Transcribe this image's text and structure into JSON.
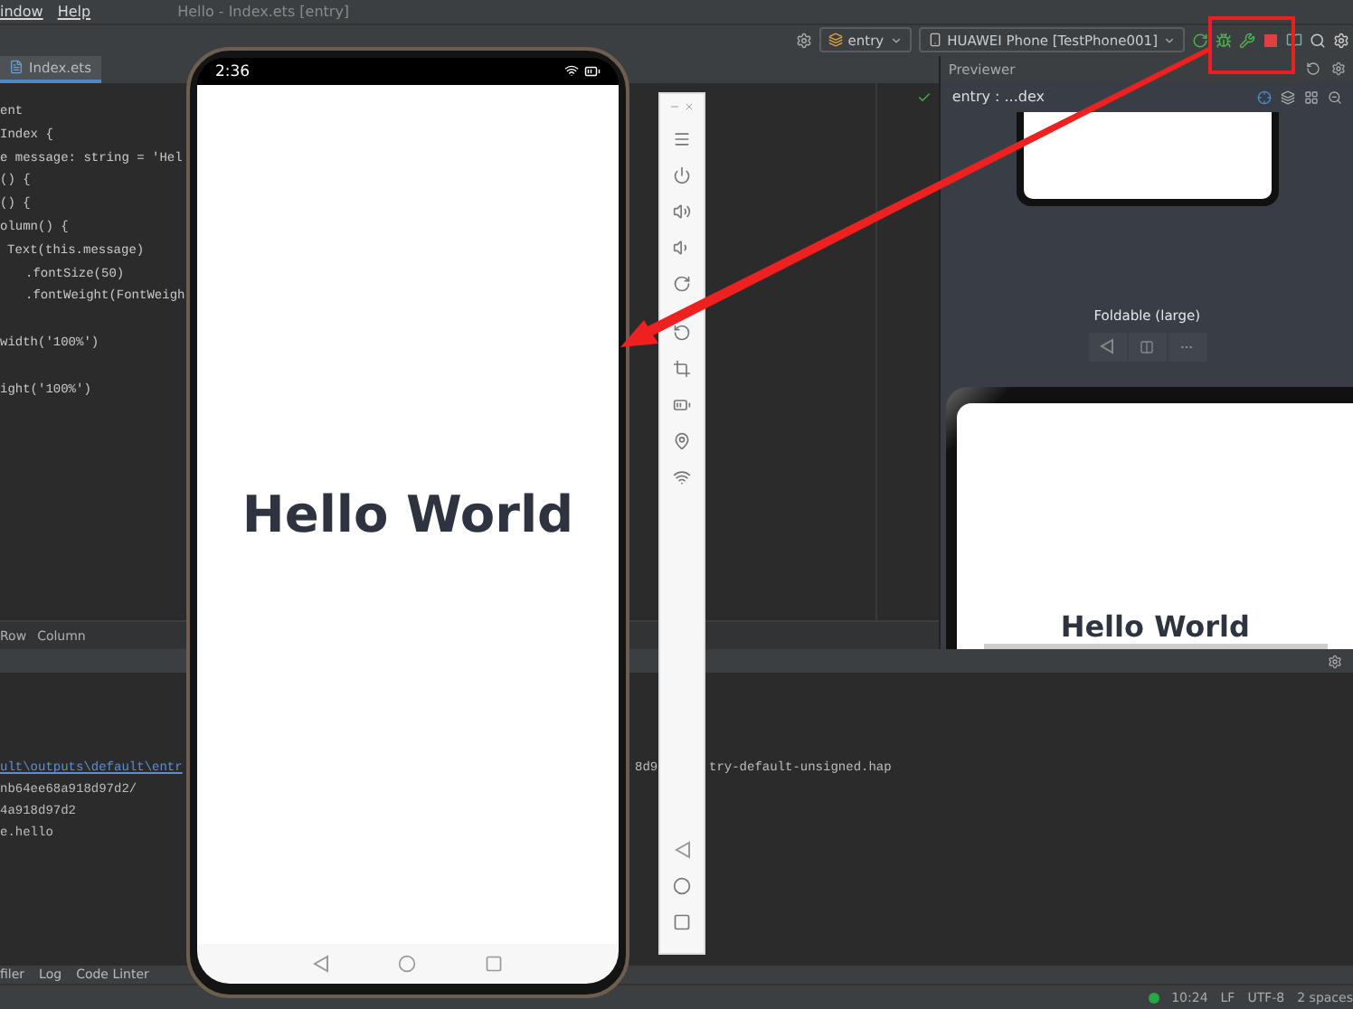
{
  "menu": [
    {
      "label": "indow"
    },
    {
      "label": "Help"
    }
  ],
  "window_title": "Hello - Index.ets [entry]",
  "toolbar": {
    "module": "entry",
    "device": "HUAWEI Phone [TestPhone001]"
  },
  "editor_tabs": [
    {
      "label": "Index.ets",
      "selected": true
    }
  ],
  "code_lines": [
    {
      "kind": "plain",
      "text": "ent"
    },
    {
      "kind": "plain",
      "text": "Index {"
    },
    {
      "kind": "plain",
      "text": "e message: string = 'Hel"
    },
    {
      "kind": "plain",
      "text": "() {"
    },
    {
      "kind": "plain",
      "text": "() {"
    },
    {
      "kind": "plain",
      "text": "olumn() {"
    },
    {
      "kind": "nested",
      "text": "Text(this.message)"
    },
    {
      "kind": "chain",
      "text": ".fontSize(50)"
    },
    {
      "kind": "chain",
      "text": ".fontWeight(FontWeigh"
    },
    {
      "kind": "blank"
    },
    {
      "kind": "plain",
      "text": "width('100%')"
    },
    {
      "kind": "blank"
    },
    {
      "kind": "plain",
      "text": "ight('100%')"
    }
  ],
  "breadcrumb": [
    "Row",
    "Column"
  ],
  "output_lines": [
    {
      "kind": "link",
      "text": "ult\\outputs\\default\\entr",
      "tails": [
        "8d9",
        "try-default-unsigned.hap"
      ]
    },
    {
      "kind": "plain",
      "text": "nb64ee68a918d97d2/"
    },
    {
      "kind": "plain",
      "text": "4a918d97d2"
    },
    {
      "kind": "plain",
      "text": "e.hello"
    }
  ],
  "bottom_tabs": [
    "filer",
    "Log",
    "Code Linter"
  ],
  "status_bar": [
    "10:24",
    "LF",
    "UTF-8",
    "2 spaces"
  ],
  "previewer": {
    "title": "Previewer",
    "path": "entry : ...dex",
    "device_label": "Foldable (large)",
    "preview_text": "Hello World"
  },
  "emulator": {
    "time": "2:36",
    "screen_text": "Hello World"
  }
}
